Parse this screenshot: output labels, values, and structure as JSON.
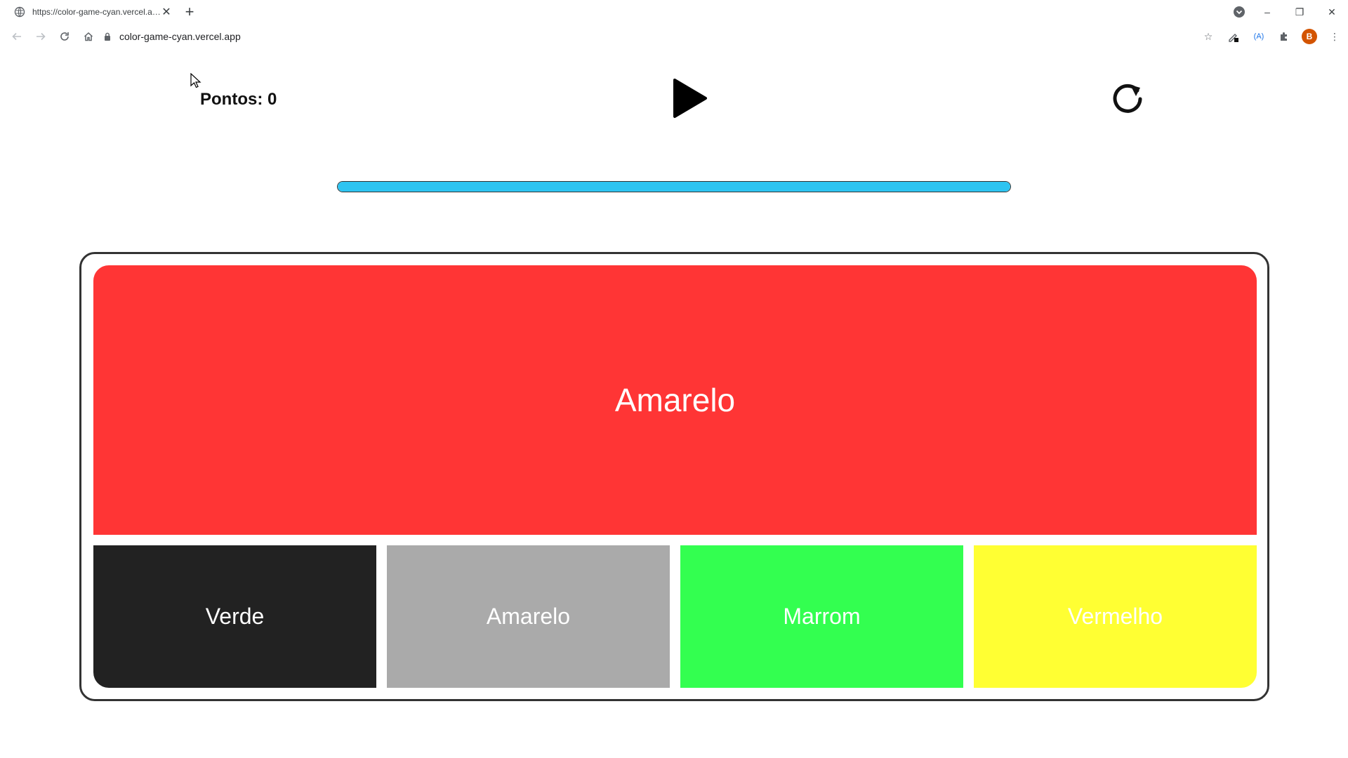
{
  "browser": {
    "tab_title": "https://color-game-cyan.vercel.app",
    "url": "color-game-cyan.vercel.app",
    "profile_initial": "B",
    "extension_label": "(A)"
  },
  "game": {
    "score_label": "Pontos:",
    "score_value": "0",
    "progress_fraction": 1.0,
    "progress_color": "#2ec4f1",
    "target": {
      "word": "Amarelo",
      "color": "#ff3535"
    },
    "options": [
      {
        "word": "Verde",
        "color": "#222222"
      },
      {
        "word": "Amarelo",
        "color": "#aaaaaa"
      },
      {
        "word": "Marrom",
        "color": "#33ff50"
      },
      {
        "word": "Vermelho",
        "color": "#ffff33"
      }
    ]
  }
}
